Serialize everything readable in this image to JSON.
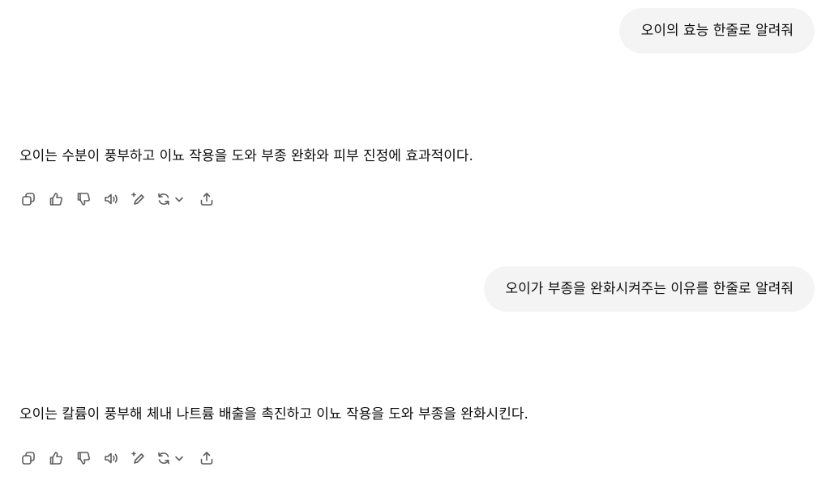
{
  "conversation": {
    "messages": [
      {
        "role": "user",
        "text": "오이의 효능 한줄로 알려줘"
      },
      {
        "role": "assistant",
        "text": "오이는 수분이 풍부하고 이뇨 작용을 도와 부종 완화와 피부 진정에 효과적이다."
      },
      {
        "role": "user",
        "text": "오이가 부종을 완화시켜주는 이유를 한줄로 알려줘"
      },
      {
        "role": "assistant",
        "text": "오이는 칼륨이 풍부해 체내 나트륨 배출을 촉진하고 이뇨 작용을 도와 부종을 완화시킨다."
      }
    ]
  },
  "action_bar": {
    "icons": [
      "copy-icon",
      "thumbs-up-icon",
      "thumbs-down-icon",
      "read-aloud-icon",
      "edit-sparkle-icon",
      "regenerate-icon",
      "chevron-down-icon",
      "share-icon"
    ]
  },
  "colors": {
    "user_bubble_bg": "#f4f4f4",
    "text": "#0d0d0d",
    "icon": "#5d5d5d"
  }
}
